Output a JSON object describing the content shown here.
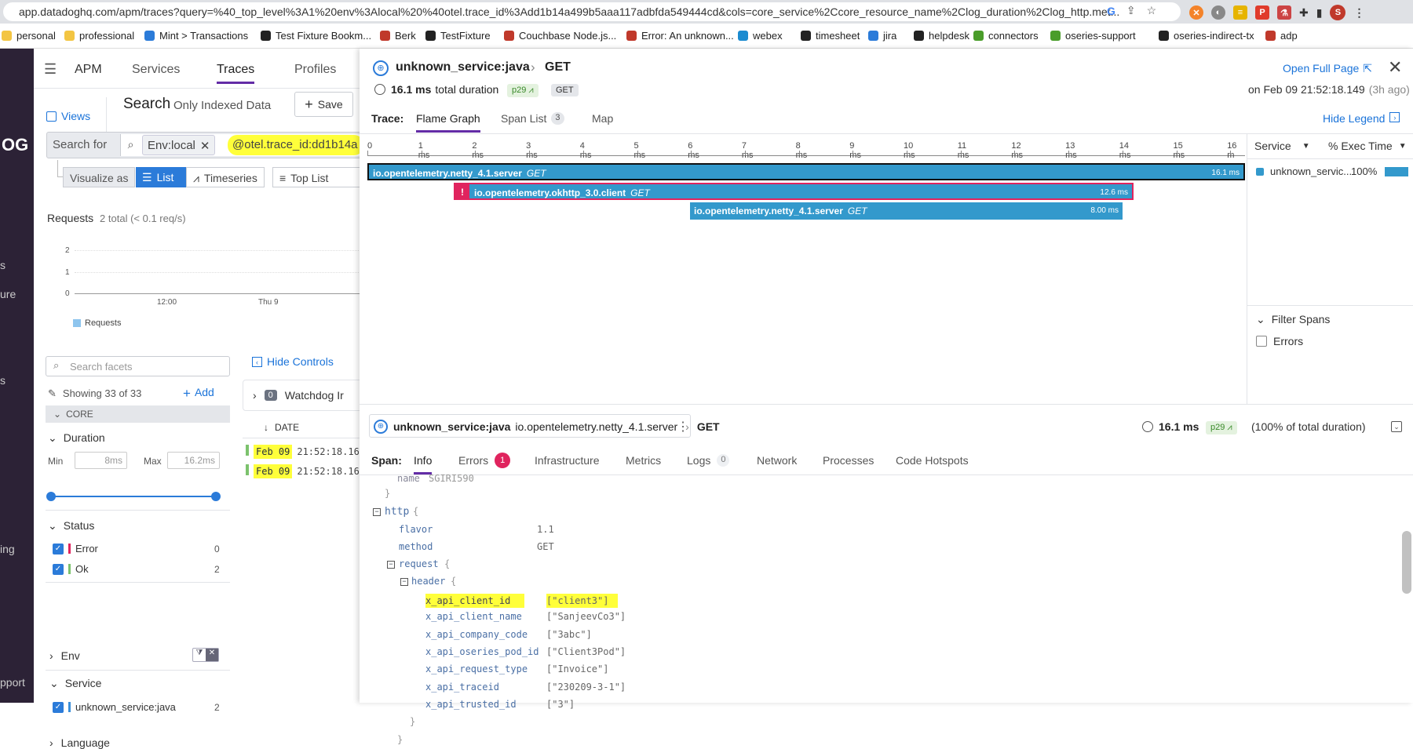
{
  "browser": {
    "url": "app.datadoghq.com/apm/traces?query=%40_top_level%3A1%20env%3Alocal%20%40otel.trace_id%3Add1b14a499b5aaa117adbfda549444cd&cols=core_service%2Ccore_resource_name%2Clog_duration%2Clog_http.met...",
    "profile_initial": "S"
  },
  "bookmarks": [
    "personal",
    "professional",
    "Mint > Transactions",
    "Test Fixture Bookm...",
    "Berk",
    "TestFixture",
    "Couchbase Node.js...",
    "Error: An unknown...",
    "webex",
    "timesheet",
    "jira",
    "helpdesk",
    "connectors",
    "oseries-support",
    "oseries-indirect-tx",
    "adp"
  ],
  "leftnav": {
    "logo": "OG",
    "items": [
      "s",
      "ure",
      "s",
      "ing",
      "pport"
    ]
  },
  "apm": {
    "title": "APM",
    "tabs": [
      "Services",
      "Traces",
      "Profiles"
    ]
  },
  "search": {
    "views_label": "Views",
    "title": "Search",
    "subtitle": "Only Indexed Data",
    "save_label": "Save",
    "search_for": "Search for",
    "env_chip": "Env:local",
    "query_chip": "@otel.trace_id:dd1b14a"
  },
  "visualize": {
    "label": "Visualize as",
    "options": [
      "List",
      "Timeseries",
      "Top List"
    ]
  },
  "requests": {
    "label": "Requests",
    "summary": "2 total (< 0.1 req/s)",
    "legend": "Requests",
    "y_ticks": [
      "2",
      "1",
      "0"
    ],
    "x_ticks": [
      "12:00",
      "Thu 9"
    ]
  },
  "facets": {
    "placeholder": "Search facets",
    "showing": "Showing 33 of 33",
    "add_label": "Add",
    "core_label": "CORE",
    "duration": {
      "label": "Duration",
      "min_label": "Min",
      "min_value": "8ms",
      "max_label": "Max",
      "max_value": "16.2ms"
    },
    "status": {
      "label": "Status",
      "items": [
        {
          "name": "Error",
          "count": "0"
        },
        {
          "name": "Ok",
          "count": "2"
        }
      ]
    },
    "env_label": "Env",
    "service": {
      "label": "Service",
      "item": "unknown_service:java",
      "count": "2"
    },
    "language_label": "Language"
  },
  "controls": {
    "hide_controls": "Hide Controls",
    "watchdog_count": "0",
    "watchdog_label": "Watchdog Ir",
    "date_col": "DATE",
    "rows": [
      {
        "date": "Feb 09",
        "time": "21:52:18.16"
      },
      {
        "date": "Feb 09",
        "time": "21:52:18.16"
      }
    ]
  },
  "trace": {
    "service": "unknown_service:java",
    "resource": "GET",
    "duration": "16.1 ms",
    "duration_suffix": "total duration",
    "percentile": "p29",
    "method": "GET",
    "open_full_page": "Open Full Page",
    "timestamp": "on Feb 09 21:52:18.149",
    "ago": "(3h ago)",
    "trace_label": "Trace:",
    "tabs": [
      {
        "label": "Flame Graph"
      },
      {
        "label": "Span List",
        "badge": "3"
      },
      {
        "label": "Map"
      }
    ],
    "hide_legend": "Hide Legend"
  },
  "flame": {
    "ticks": [
      "0",
      "1 ms",
      "2 ms",
      "3 ms",
      "4 ms",
      "5 ms",
      "6 ms",
      "7 ms",
      "8 ms",
      "9 ms",
      "10 ms",
      "11 ms",
      "12 ms",
      "13 ms",
      "14 ms",
      "15 ms",
      "16 m"
    ],
    "spans": [
      {
        "name": "io.opentelemetry.netty_4.1.server",
        "method": "GET",
        "duration": "16.1 ms",
        "error": false
      },
      {
        "name": "io.opentelemetry.okhttp_3.0.client",
        "method": "GET",
        "duration": "12.6 ms",
        "error": true
      },
      {
        "name": "io.opentelemetry.netty_4.1.server",
        "method": "GET",
        "duration": "8.00 ms",
        "error": false
      }
    ]
  },
  "legend": {
    "service_col": "Service",
    "exec_col": "% Exec Time",
    "row_service": "unknown_servic...",
    "row_pct": "100%",
    "filter_spans": "Filter Spans",
    "errors_label": "Errors"
  },
  "span": {
    "service": "unknown_service:java",
    "operation": "io.opentelemetry.netty_4.1.server",
    "resource": "GET",
    "duration": "16.1 ms",
    "percentile": "p29",
    "pct_total": "(100% of total duration)",
    "label": "Span:",
    "tabs": [
      {
        "label": "Info"
      },
      {
        "label": "Errors",
        "badge": "1"
      },
      {
        "label": "Infrastructure"
      },
      {
        "label": "Metrics"
      },
      {
        "label": "Logs",
        "badge": "0"
      },
      {
        "label": "Network"
      },
      {
        "label": "Processes"
      },
      {
        "label": "Code Hotspots"
      }
    ]
  },
  "attributes": {
    "prev_key": "name",
    "prev_value": "SGIRI590",
    "close1": "}",
    "http_key": "http",
    "brace": "{",
    "flavor_key": "flavor",
    "flavor_value": "1.1",
    "method_key": "method",
    "method_value": "GET",
    "request_key": "request",
    "header_key": "header",
    "headers": [
      {
        "key": "x_api_client_id",
        "value": "[\"client3\"]"
      },
      {
        "key": "x_api_client_name",
        "value": "[\"SanjeevCo3\"]"
      },
      {
        "key": "x_api_company_code",
        "value": "[\"3abc\"]"
      },
      {
        "key": "x_api_oseries_pod_id",
        "value": "[\"Client3Pod\"]"
      },
      {
        "key": "x_api_request_type",
        "value": "[\"Invoice\"]"
      },
      {
        "key": "x_api_traceid",
        "value": "[\"230209-3-1\"]"
      },
      {
        "key": "x_api_trusted_id",
        "value": "[\"3\"]"
      }
    ]
  },
  "colors": {
    "brand": "#632ca6",
    "span": "#3399cc",
    "error": "#e0245e",
    "highlight": "#ffff3a",
    "link": "#1a73d9"
  }
}
